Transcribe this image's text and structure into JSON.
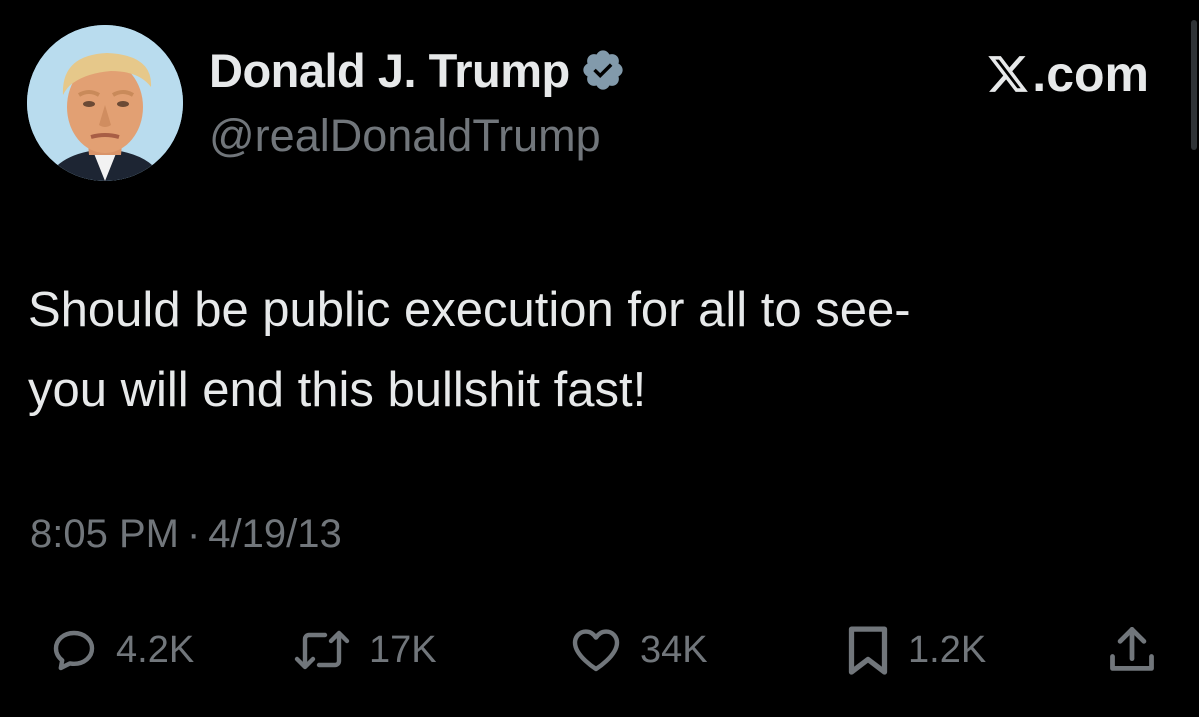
{
  "author": {
    "display_name": "Donald J. Trump",
    "handle": "@realDonaldTrump",
    "verified": true,
    "avatar": "profile-photo"
  },
  "site": {
    "logo_glyph": "𝕏",
    "logo_text": ".com"
  },
  "tweet": {
    "text": "Should be public execution for all to see-\nyou will end this bullshit fast!",
    "time": "8:05 PM",
    "separator": "·",
    "date": "4/19/13"
  },
  "actions": {
    "reply": {
      "icon": "reply-icon",
      "count": "4.2K"
    },
    "repost": {
      "icon": "repost-icon",
      "count": "17K"
    },
    "like": {
      "icon": "heart-icon",
      "count": "34K"
    },
    "bookmark": {
      "icon": "bookmark-icon",
      "count": "1.2K"
    },
    "share": {
      "icon": "share-icon"
    }
  },
  "colors": {
    "background": "#000000",
    "primary_text": "#e7e9ea",
    "secondary_text": "#71767b",
    "verified_badge": "#829aab"
  }
}
